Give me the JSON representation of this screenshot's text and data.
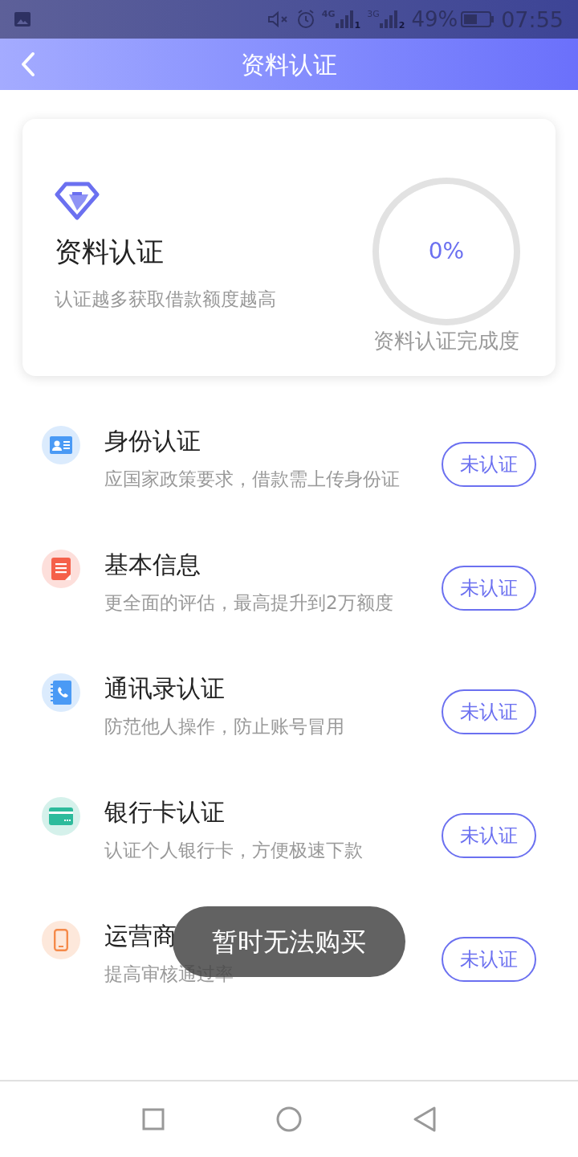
{
  "status_bar": {
    "network_1": "4G",
    "sim_1": "1",
    "network_2": "3G",
    "sim_2": "2",
    "battery": "49%",
    "time": "07:55"
  },
  "header": {
    "title": "资料认证"
  },
  "summary": {
    "title": "资料认证",
    "subtitle": "认证越多获取借款额度越高",
    "progress": {
      "level": 0,
      "reading": "0%",
      "label": "资料认证完成度"
    }
  },
  "items": [
    {
      "kind": "id-card",
      "color": "#4a9af5",
      "title": "身份认证",
      "description": "应国家政策要求，借款需上传身份证",
      "status": "未认证"
    },
    {
      "kind": "document",
      "color": "#f5604a",
      "title": "基本信息",
      "description": "更全面的评估，最高提升到2万额度",
      "status": "未认证"
    },
    {
      "kind": "contacts",
      "color": "#4a9af5",
      "title": "通讯录认证",
      "description": "防范他人操作，防止账号冒用",
      "status": "未认证"
    },
    {
      "kind": "bank-card",
      "color": "#2dbb9c",
      "title": "银行卡认证",
      "description": "认证个人银行卡，方便极速下款",
      "status": "未认证"
    },
    {
      "kind": "phone",
      "color": "#f58a4a",
      "title": "运营商",
      "description": "提高审核通过率",
      "status": "未认证"
    }
  ],
  "toast": {
    "message": "暂时无法购买"
  }
}
